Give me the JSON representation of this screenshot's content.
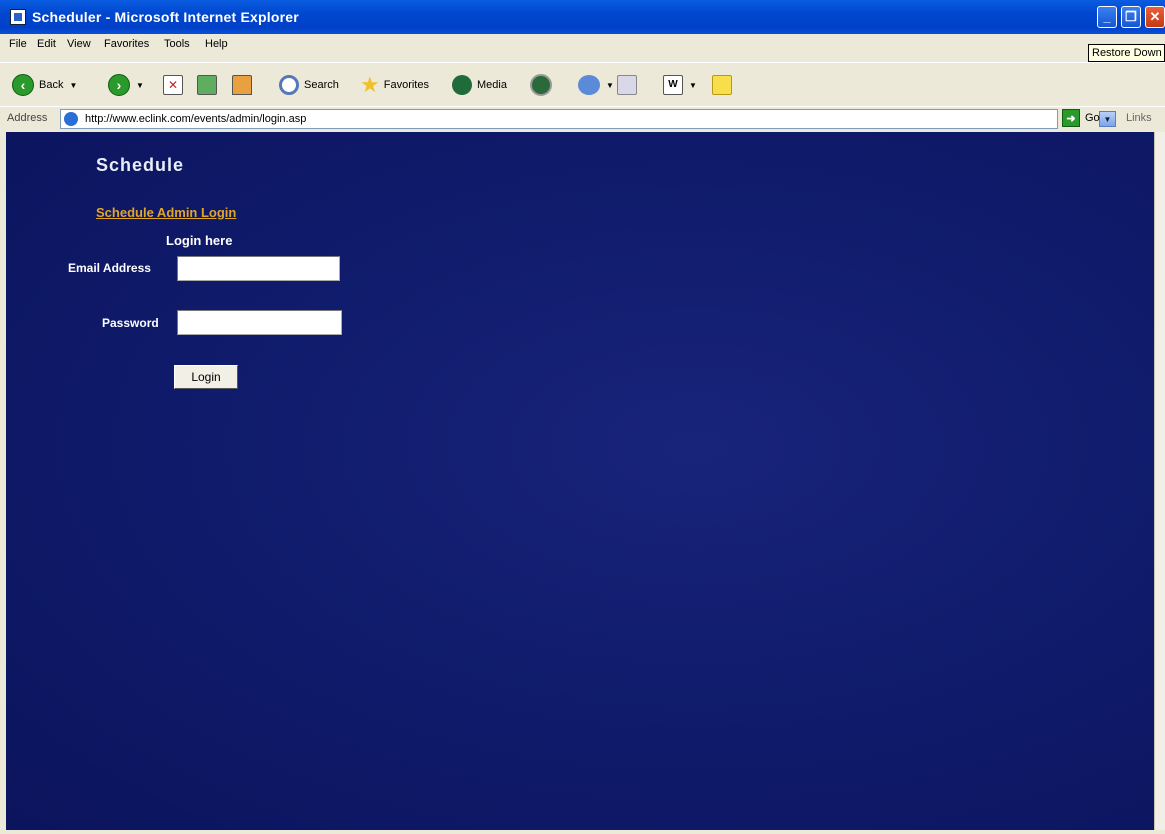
{
  "window": {
    "title": "Scheduler - Microsoft Internet Explorer",
    "controls": {
      "minimize": "_",
      "maximize": "❐",
      "close": "✕"
    },
    "tooltip": "Restore Down"
  },
  "menu": [
    "File",
    "Edit",
    "View",
    "Favorites",
    "Tools",
    "Help"
  ],
  "toolbar": {
    "back": "Back",
    "search": "Search",
    "favorites": "Favorites",
    "media": "Media"
  },
  "address": {
    "label": "Address",
    "url": "http://www.eclink.com/events/admin/login.asp",
    "go": "Go",
    "links": "Links"
  },
  "page": {
    "title": "Schedule",
    "admin_link": "Schedule Admin Login",
    "login_here": "Login here",
    "email_label": "Email Address",
    "email_value": "",
    "password_label": "Password",
    "password_value": "",
    "login_button": "Login"
  },
  "colors": {
    "page_background": "#0f1a6a",
    "link": "#e0a62a",
    "titlebar": "#0047cf"
  }
}
